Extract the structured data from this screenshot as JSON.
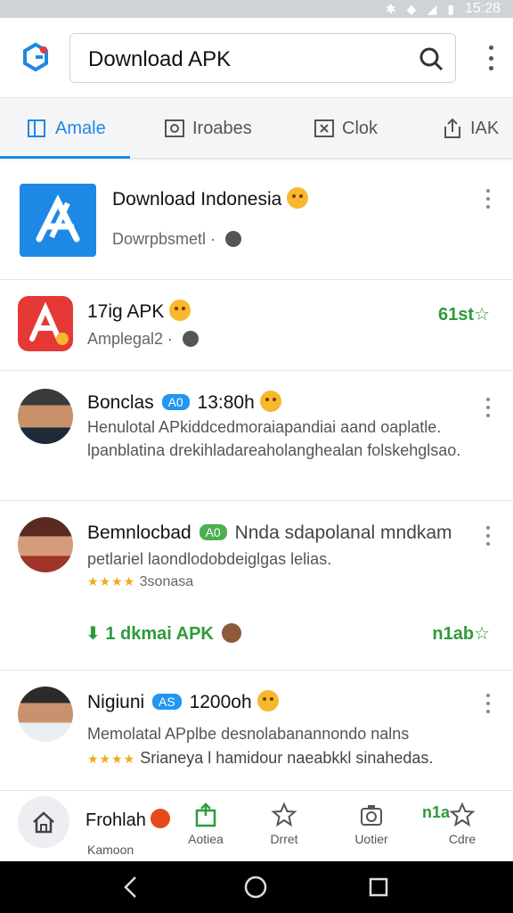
{
  "status_bar": {
    "time": "15:28"
  },
  "search": {
    "query": "Download APK"
  },
  "tabs": [
    {
      "label": "Amale",
      "icon": "book-icon",
      "active": true
    },
    {
      "label": "Iroabes",
      "icon": "image-icon",
      "active": false
    },
    {
      "label": "Clok",
      "icon": "close-box-icon",
      "active": false
    },
    {
      "label": "IAK",
      "icon": "share-icon",
      "active": false
    }
  ],
  "items": [
    {
      "title": "Download Indonesia",
      "subtitle": "Dowrpbsmetl ·"
    },
    {
      "title": "17ig APK",
      "subtitle": "Amplegal2 ·",
      "price": "61st"
    },
    {
      "title": "Bonclas",
      "badge": "A0",
      "time": "13:80h",
      "description": "Henulotal APkiddcedmoraiapandiai aand oaplatle. lpanblatina drekihladareaholanghealan folskehglsao."
    },
    {
      "title": "Bemnlocbad",
      "badge": "A0",
      "headline": "Nnda sdapolanal mndkam",
      "description": "petlariel laondlodobdeiglgas lelias.",
      "rating_text": "3sonasa",
      "download_label": "1 dkmai APK",
      "price": "n1ab"
    },
    {
      "title": "Nigiuni",
      "badge": "AS",
      "time": "1200oh",
      "description": "Memolatal APplbe desnolabanannondo nalns",
      "rating_text": "Srianeya l hamidour naeabkkl sinahedas."
    }
  ],
  "partial_item": {
    "title": "Frohlah"
  },
  "bottom_nav": [
    {
      "label": "Kamoon",
      "icon": "home-icon"
    },
    {
      "label": "Aotiea",
      "icon": "bag-icon"
    },
    {
      "label": "Drret",
      "icon": "star-outline-icon"
    },
    {
      "label": "Uotier",
      "icon": "camera-icon"
    },
    {
      "label": "Cdre",
      "icon": "star-icon",
      "price": "n1a"
    }
  ],
  "colors": {
    "accent": "#1e88e5",
    "price_green": "#2e9b3a",
    "badge_blue": "#2196f3",
    "badge_green": "#4caf50"
  }
}
